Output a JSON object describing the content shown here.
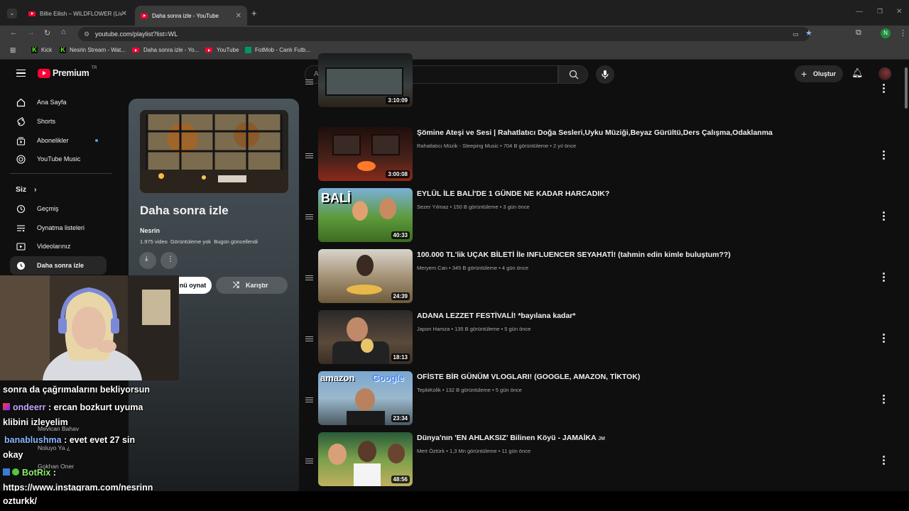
{
  "browser": {
    "tabs": [
      {
        "title": "Billie Eilish – WILDFLOWER (Liv",
        "active": false
      },
      {
        "title": "Daha sonra izle - YouTube",
        "active": true
      }
    ],
    "url": "youtube.com/playlist?list=WL",
    "bookmarks": [
      "Kick",
      "Nesrin Stream - Wat...",
      "Daha sonra izle - Yo...",
      "YouTube",
      "FotMob - Canlı Futb..."
    ],
    "profile_initial": "N"
  },
  "masthead": {
    "logo_text": "Premium",
    "logo_region": "TR",
    "search_placeholder": "Ara",
    "create_label": "Oluştur"
  },
  "sidebar": {
    "items": [
      {
        "label": "Ana Sayfa",
        "icon": "home-icon"
      },
      {
        "label": "Shorts",
        "icon": "shorts-icon"
      },
      {
        "label": "Abonelikler",
        "icon": "subscriptions-icon"
      },
      {
        "label": "YouTube Music",
        "icon": "music-icon"
      }
    ],
    "you_label": "Siz",
    "you_items": [
      {
        "label": "Geçmiş",
        "icon": "history-icon"
      },
      {
        "label": "Oynatma listeleri",
        "icon": "playlists-icon"
      },
      {
        "label": "Videolarınız",
        "icon": "videos-icon"
      },
      {
        "label": "Daha sonra izle",
        "icon": "clock-icon",
        "active": true
      }
    ]
  },
  "playlist": {
    "title": "Daha sonra izle",
    "owner": "Nesrin",
    "stats": "1.975 video  Görüntüleme yok  Bugün güncellendi",
    "play_all_label": "nü oynat",
    "shuffle_label": "Karıştır"
  },
  "videos": [
    {
      "title": "",
      "channel": "",
      "meta": "",
      "duration": "3:10:09",
      "color": "#2a2f30"
    },
    {
      "title": "Şömine Ateşi ve Sesi | Rahatlatıcı Doğa Sesleri,Uyku Müziği,Beyaz Gürültü,Ders Çalışma,Odaklanma",
      "channel": "Rahatlatıcı Müzik - Sleeping Music",
      "meta": "704 B görüntüleme • 2 yıl önce",
      "duration": "3:00:08",
      "color": "#3a1f1a"
    },
    {
      "title": "EYLÜL İLE BALİ'DE 1 GÜNDE NE KADAR HARCADIK?",
      "channel": "Sezer Yılmaz",
      "meta": "150 B görüntüleme • 3 gün önce",
      "duration": "40:33",
      "color": "#4c7a2c"
    },
    {
      "title": "100.000 TL'lik UÇAK BİLETİ İle INFLUENCER SEYAHATİ! (tahmin edin kimle buluştum??)",
      "channel": "Meryem Can",
      "meta": "345 B görüntüleme • 4 gün önce",
      "duration": "24:39",
      "color": "#6e5a3c"
    },
    {
      "title": "ADANA LEZZET FESTİVALİ! *bayılana kadar*",
      "channel": "Japon Hamza",
      "meta": "135 B görüntüleme • 5 gün önce",
      "duration": "18:13",
      "color": "#3f3a34"
    },
    {
      "title": "OFİSTE BİR GÜNÜM VLOGLARI! (GOOGLE, AMAZON, TİKTOK)",
      "channel": "TepkiKolik",
      "meta": "132 B görüntüleme • 5 gün önce",
      "duration": "23:34",
      "color": "#4f7aa0"
    },
    {
      "title": "Dünya'nın 'EN AHLAKSIZ' Bilinen Köyü - JAMAİKA",
      "channel": "Mert Öztürk",
      "meta": "1,3 Mn görüntüleme • 11 gün önce",
      "duration": "48:56",
      "color": "#2d5a3a"
    }
  ],
  "thumb_texts": [
    "BALİ",
    "amazon",
    "Google"
  ],
  "overlay": {
    "chat": [
      {
        "user": "",
        "text": "sonra da çağrımalarını bekliyorsun"
      },
      {
        "user": "ondeerr",
        "text": ": ercan bozkurt uyuma"
      },
      {
        "user": "",
        "text": "klibini izleyelim"
      },
      {
        "user": "banablushma",
        "text": ": evet evet 27 sin"
      },
      {
        "user": "",
        "text": "okay"
      },
      {
        "user": "BotRix",
        "text": ":"
      },
      {
        "user": "",
        "text": "https://www.instagram.com/nesrinn"
      },
      {
        "user": "",
        "text": "ozturkk/"
      }
    ],
    "ghost_names": [
      "Mevlcan Bahav",
      "Noluyo Ya ¿",
      "Gokhan Oner"
    ]
  }
}
